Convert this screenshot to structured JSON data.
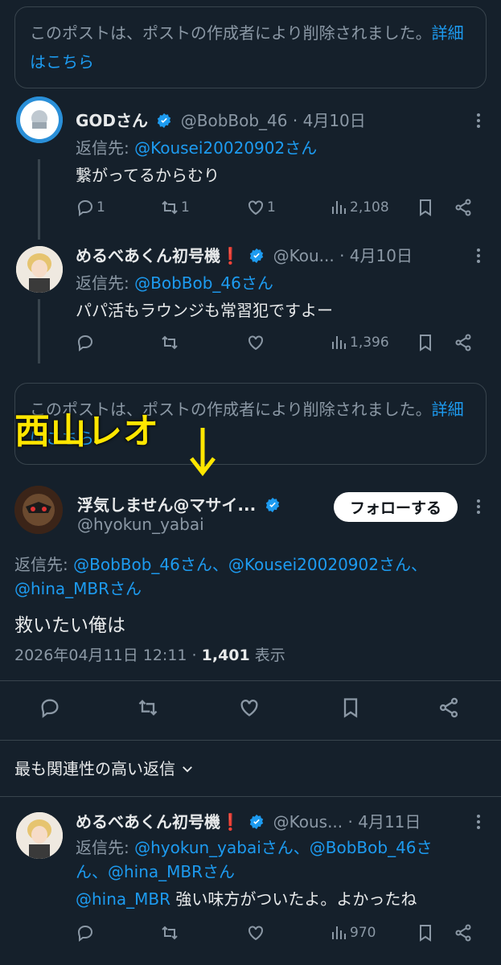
{
  "deleted_top": {
    "text": "このポストは、ポストの作成者により削除されました。",
    "more": "詳細はこちら"
  },
  "tweet1": {
    "name": "GODさん",
    "handle": "@BobBob_46",
    "date": "· 4月10日",
    "reply_label": "返信先:",
    "reply_to": "@Kousei20020902さん",
    "text": "繋がってるからむり",
    "replies": "1",
    "retweets": "1",
    "likes": "1",
    "views": "2,108"
  },
  "tweet2": {
    "name": "めるべあくん初号機❗",
    "handle": "@Kou...",
    "date": "· 4月10日",
    "reply_label": "返信先:",
    "reply_to": "@BobBob_46さん",
    "text": "パパ活もラウンジも常習犯ですよー",
    "views": "1,396"
  },
  "deleted_mid": {
    "text": "このポストは、ポストの作成者により削除されました。",
    "more": "詳細はこちら"
  },
  "annotation": {
    "label": "西山レオ",
    "arrow": "↓"
  },
  "main_tweet": {
    "name": "浮気しません@マサイ...",
    "handle": "@hyokun_yabai",
    "follow": "フォローする",
    "reply_label": "返信先:",
    "reply_to_1": "@BobBob_46さん、@Kousei20020902さん、",
    "reply_to_2": "@hina_MBRさん",
    "text": "救いたい俺は",
    "datetime": "2026年04月11日 12:11 ·",
    "views": "1,401",
    "views_label": "表示"
  },
  "sort_label": "最も関連性の高い返信",
  "tweet3": {
    "name": "めるべあくん初号機❗",
    "handle": "@Kous...",
    "date": "· 4月11日",
    "reply_label": "返信先:",
    "reply_to_1": "@hyokun_yabaiさん、@BobBob_46さ",
    "reply_to_2": "ん、@hina_MBRさん",
    "mention": "@hina_MBR",
    "text": " 強い味方がついたよ。よかったね",
    "views": "970"
  },
  "colors": {
    "background": "#15202b",
    "accent": "#1d9bf0",
    "muted": "#8b98a5",
    "annotation": "#ffe600"
  }
}
